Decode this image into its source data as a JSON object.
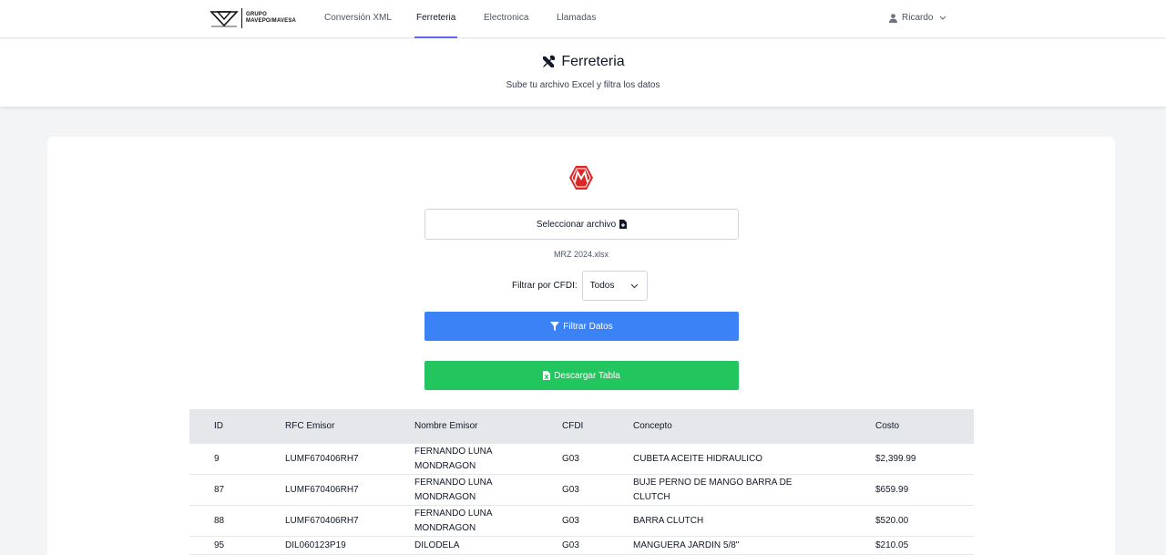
{
  "nav": {
    "logo_text_line1": "GRUPO",
    "logo_text_line2": "MAVEPO/MAVESA",
    "links": [
      "Conversión XML",
      "Ferreteria",
      "Electronica",
      "Llamadas"
    ],
    "active_link": "Ferreteria",
    "user_name": "Ricardo"
  },
  "header": {
    "title": "Ferreteria",
    "subtitle": "Sube tu archivo Excel y filtra los datos"
  },
  "upload": {
    "button_label": "Seleccionar archivo",
    "file_name": "MRZ 2024.xlsx"
  },
  "filter": {
    "label": "Filtrar por CFDI:",
    "selected": "Todos"
  },
  "actions": {
    "filter_label": "Filtrar Datos",
    "download_label": "Descargar Tabla"
  },
  "table": {
    "columns": [
      "ID",
      "RFC Emisor",
      "Nombre Emisor",
      "CFDI",
      "Concepto",
      "Costo"
    ],
    "rows": [
      [
        "9",
        "LUMF670406RH7",
        "FERNANDO LUNA MONDRAGON",
        "G03",
        "CUBETA ACEITE HIDRAULICO",
        "$2,399.99"
      ],
      [
        "87",
        "LUMF670406RH7",
        "FERNANDO LUNA MONDRAGON",
        "G03",
        "BUJE PERNO DE MANGO BARRA DE CLUTCH",
        "$659.99"
      ],
      [
        "88",
        "LUMF670406RH7",
        "FERNANDO LUNA MONDRAGON",
        "G03",
        "BARRA CLUTCH",
        "$520.00"
      ],
      [
        "95",
        "DIL060123P19",
        "DILODELA",
        "G03",
        "MANGUERA JARDIN 5/8\"",
        "$210.05"
      ]
    ]
  },
  "colors": {
    "primary_blue": "#3b82f6",
    "success_green": "#22c55e",
    "active_underline": "#6366f1",
    "brand_red": "#dc2626"
  }
}
